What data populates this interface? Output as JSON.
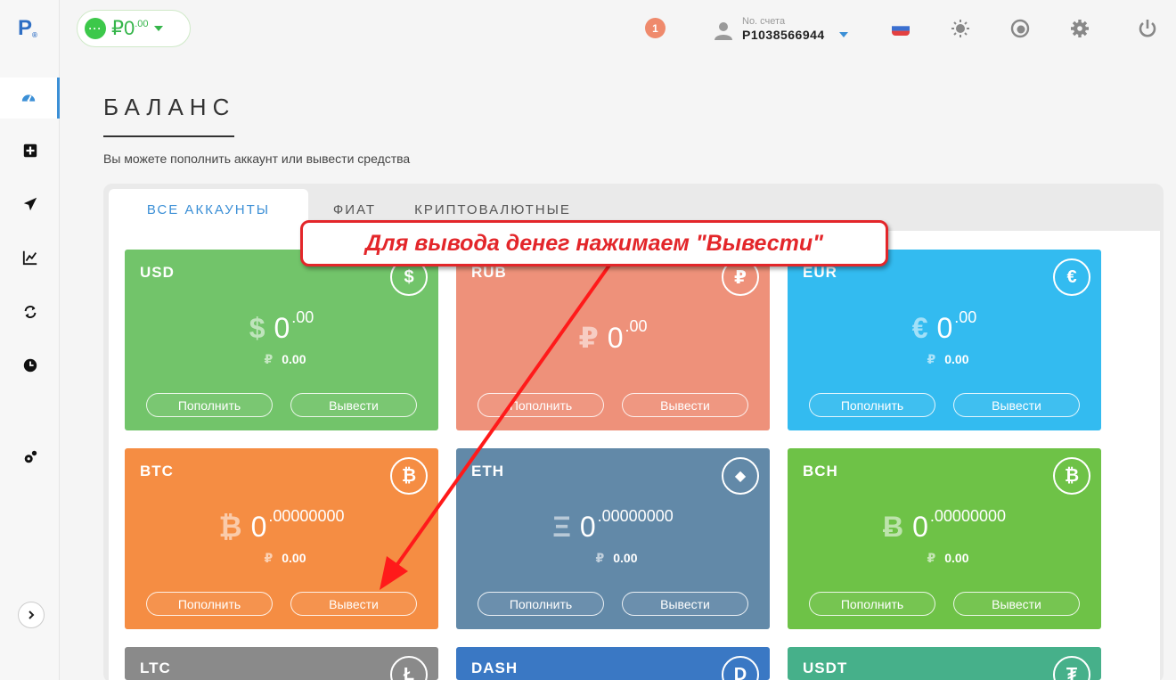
{
  "logo": {
    "letter": "P",
    "mark": "®"
  },
  "header": {
    "balance_currency": "₽",
    "balance_int": "0",
    "balance_frac": ".00",
    "notifications": "1",
    "account_label": "No. счета",
    "account_number": "P1038566944"
  },
  "page": {
    "title": "БАЛАНС",
    "subtitle": "Вы можете пополнить аккаунт или вывести средства"
  },
  "tabs": [
    "ВСЕ АККАУНТЫ",
    "ФИАТ",
    "КРИПТОВАЛЮТНЫЕ"
  ],
  "active_tab": 0,
  "callout": "Для вывода денег нажимаем \"Вывести\"",
  "buttons": {
    "deposit": "Пополнить",
    "withdraw": "Вывести"
  },
  "cards": [
    {
      "code": "USD",
      "symbol": "$",
      "badge": "$",
      "int": "0",
      "frac": ".00",
      "rub_symbol": "₽",
      "rub": "0.00",
      "color": "#72c46a"
    },
    {
      "code": "RUB",
      "symbol": "₽",
      "badge": "₽",
      "int": "0",
      "frac": ".00",
      "rub_symbol": "",
      "rub": "",
      "color": "#ee917a"
    },
    {
      "code": "EUR",
      "symbol": "€",
      "badge": "€",
      "int": "0",
      "frac": ".00",
      "rub_symbol": "₽",
      "rub": "0.00",
      "color": "#33bbf0"
    },
    {
      "code": "BTC",
      "symbol": "₿",
      "badge": "₿",
      "int": "0",
      "frac": ".00000000",
      "rub_symbol": "₽",
      "rub": "0.00",
      "color": "#f58d43"
    },
    {
      "code": "ETH",
      "symbol": "Ξ",
      "badge": "◆",
      "int": "0",
      "frac": ".00000000",
      "rub_symbol": "₽",
      "rub": "0.00",
      "color": "#6289a8"
    },
    {
      "code": "BCH",
      "symbol": "Ƀ",
      "badge": "₿",
      "int": "0",
      "frac": ".00000000",
      "rub_symbol": "₽",
      "rub": "0.00",
      "color": "#6ec247"
    },
    {
      "code": "LTC",
      "symbol": "",
      "badge": "Ł",
      "int": "",
      "frac": "",
      "rub_symbol": "",
      "rub": "",
      "color": "#8a8a8a"
    },
    {
      "code": "DASH",
      "symbol": "",
      "badge": "D",
      "int": "",
      "frac": "",
      "rub_symbol": "",
      "rub": "",
      "color": "#3a78c4"
    },
    {
      "code": "USDT",
      "symbol": "",
      "badge": "₮",
      "int": "",
      "frac": "",
      "rub_symbol": "",
      "rub": "",
      "color": "#46b08a"
    }
  ]
}
